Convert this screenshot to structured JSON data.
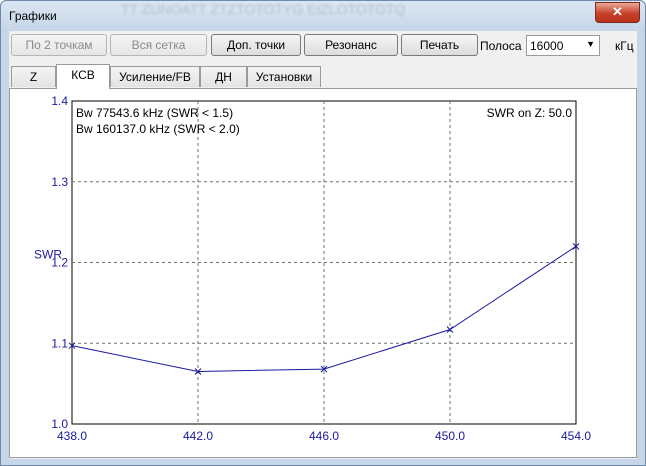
{
  "window": {
    "title": "Графики",
    "close_glyph": "✕",
    "bg_text": "TT  ZUNOATT    ZTZTOTOTYG    EIZLOTOTOTQ"
  },
  "toolbar": {
    "btn_2points": "По 2 точкам",
    "btn_all_grid": "Вся сетка",
    "btn_extra_points": "Доп. точки",
    "btn_resonance": "Резонанс",
    "btn_print": "Печать",
    "band_label": "Полоса",
    "band_value": "16000",
    "band_unit": "кГц"
  },
  "tabs": [
    "Z",
    "КСВ",
    "Усиление/FB",
    "ДН",
    "Установки"
  ],
  "active_tab": "КСВ",
  "chart_data": {
    "type": "line",
    "ylabel": "SWR",
    "xlabel": "",
    "xlim": [
      438.0,
      454.0
    ],
    "ylim": [
      1.0,
      1.4
    ],
    "x_ticks": [
      "438.0",
      "442.0",
      "446.0",
      "450.0",
      "454.0"
    ],
    "y_ticks": [
      "1.0",
      "1.1",
      "1.2",
      "1.3",
      "1.4"
    ],
    "x": [
      438.0,
      442.0,
      446.0,
      450.0,
      454.0
    ],
    "y": [
      1.097,
      1.065,
      1.068,
      1.117,
      1.22
    ],
    "grid": true,
    "annotations": {
      "bw1": "Bw 77543.6 kHz (SWR < 1.5)",
      "bw2": "Bw 160137.0 kHz (SWR < 2.0)",
      "swr_on_z": "SWR on Z: 50.0"
    },
    "colors": {
      "line": "#1a1aa0",
      "axis_text": "#1a1aa0",
      "grid": "#707070"
    }
  }
}
